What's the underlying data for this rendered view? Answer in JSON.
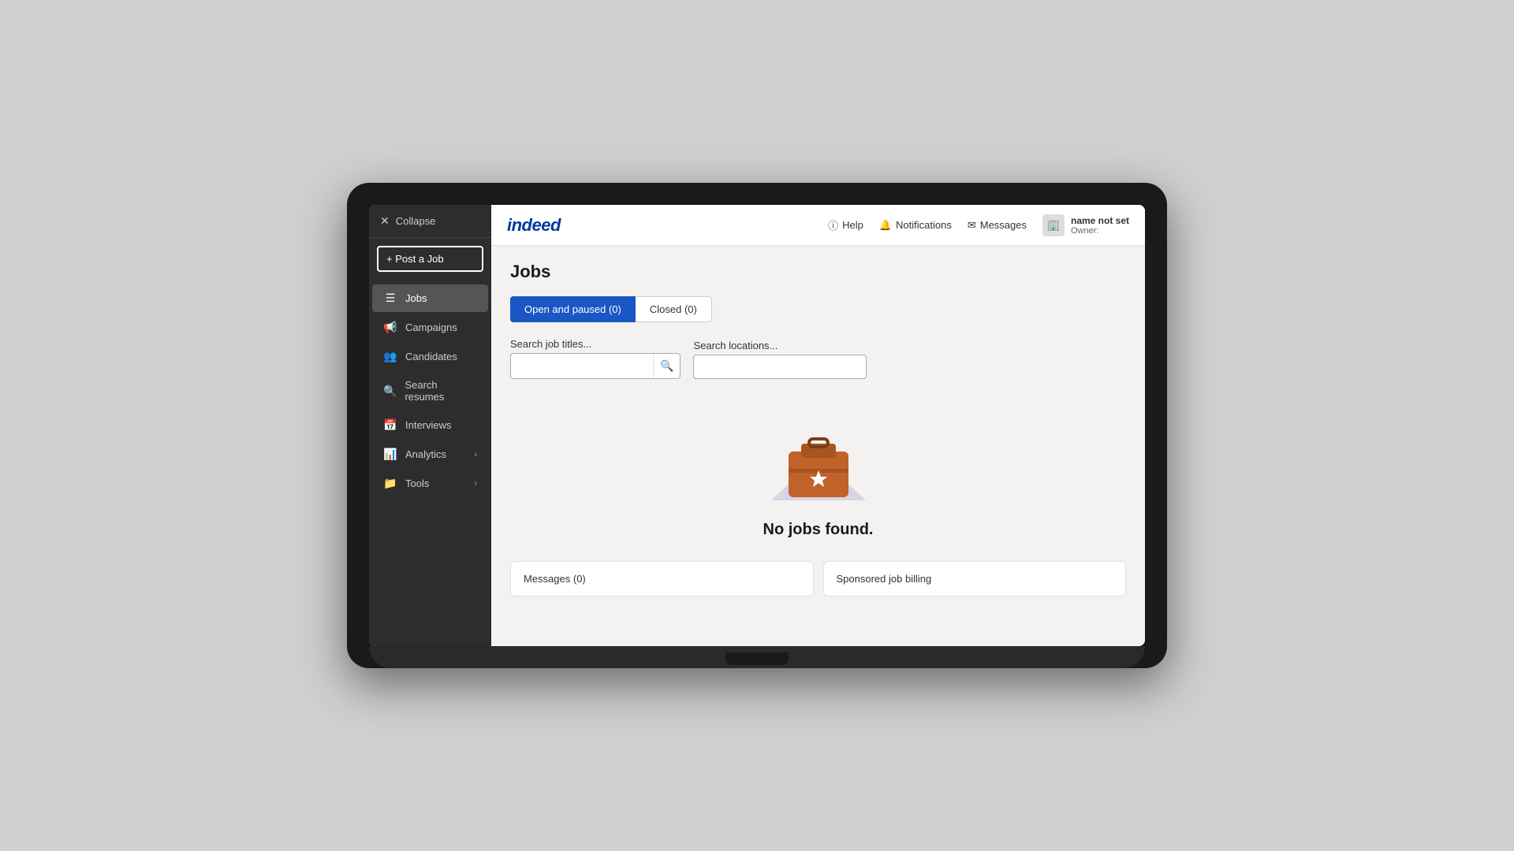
{
  "header": {
    "logo": "indeed",
    "nav": [
      {
        "id": "help",
        "label": "Help",
        "icon": "?"
      },
      {
        "id": "notifications",
        "label": "Notifications",
        "icon": "🔔"
      },
      {
        "id": "messages",
        "label": "Messages",
        "icon": "✉"
      }
    ],
    "user": {
      "name": "name not set",
      "role": "Owner:"
    }
  },
  "sidebar": {
    "collapse_label": "Collapse",
    "post_job_label": "+ Post a Job",
    "items": [
      {
        "id": "jobs",
        "label": "Jobs",
        "icon": "☰",
        "active": true
      },
      {
        "id": "campaigns",
        "label": "Campaigns",
        "icon": "📢",
        "active": false
      },
      {
        "id": "candidates",
        "label": "Candidates",
        "icon": "👥",
        "active": false
      },
      {
        "id": "search-resumes",
        "label": "Search resumes",
        "icon": "🔍",
        "active": false
      },
      {
        "id": "interviews",
        "label": "Interviews",
        "icon": "📅",
        "active": false
      },
      {
        "id": "analytics",
        "label": "Analytics",
        "icon": "📊",
        "has_chevron": true,
        "active": false
      },
      {
        "id": "tools",
        "label": "Tools",
        "icon": "📁",
        "has_chevron": true,
        "active": false
      }
    ]
  },
  "page": {
    "title": "Jobs",
    "tabs": [
      {
        "id": "open-paused",
        "label": "Open and paused (0)",
        "active": true
      },
      {
        "id": "closed",
        "label": "Closed (0)",
        "active": false
      }
    ],
    "search": {
      "title_label": "Search job titles...",
      "title_placeholder": "",
      "location_label": "Search locations...",
      "location_placeholder": ""
    },
    "empty_state": {
      "message": "No jobs found."
    },
    "bottom_cards": [
      {
        "id": "messages-card",
        "label": "Messages (0)"
      },
      {
        "id": "billing-card",
        "label": "Sponsored job billing"
      }
    ]
  }
}
